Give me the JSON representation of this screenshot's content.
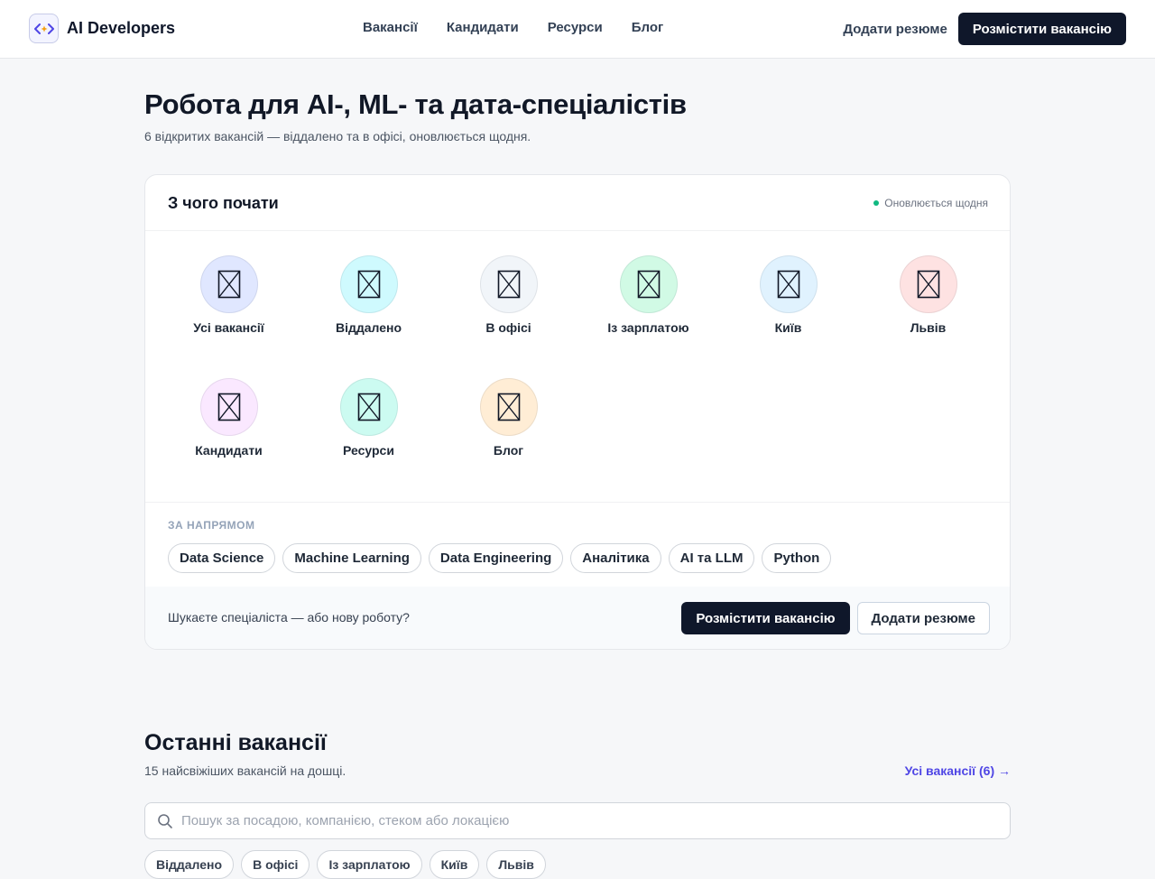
{
  "brand": {
    "name": "AI Developers",
    "icon": "code-brackets-icon",
    "accent": "#4f46e5"
  },
  "nav": {
    "items": [
      "Вакансії",
      "Кандидати",
      "Ресурси",
      "Блог"
    ]
  },
  "header": {
    "add_resume": "Додати резюме",
    "post_job": "Розмістити вакансію"
  },
  "hero": {
    "title": "Робота для AI-, ML- та дата-спеціалістів",
    "subtitle": "6 відкритих вакансій — віддалено та в офісі, оновлюється щодня."
  },
  "start": {
    "title": "З чого почати",
    "status": "Оновлюється щодня",
    "status_color": "#10b981",
    "tiles": [
      {
        "label": "Усі вакансії",
        "icon": "image-placeholder-icon",
        "color": "#e0e7ff"
      },
      {
        "label": "Віддалено",
        "icon": "image-placeholder-icon",
        "color": "#cffafe"
      },
      {
        "label": "В офісі",
        "icon": "image-placeholder-icon",
        "color": "#f1f5f9"
      },
      {
        "label": "Із зарплатою",
        "icon": "image-placeholder-icon",
        "color": "#d1fae5"
      },
      {
        "label": "Київ",
        "icon": "image-placeholder-icon",
        "color": "#e0f2fe"
      },
      {
        "label": "Львів",
        "icon": "image-placeholder-icon",
        "color": "#fee2e2"
      },
      {
        "label": "Кандидати",
        "icon": "image-placeholder-icon",
        "color": "#fae8ff"
      },
      {
        "label": "Ресурси",
        "icon": "image-placeholder-icon",
        "color": "#ccfbf1"
      },
      {
        "label": "Блог",
        "icon": "image-placeholder-icon",
        "color": "#ffedd5"
      }
    ],
    "direction_label": "ЗА НАПРЯМОМ",
    "directions": [
      "Data Science",
      "Machine Learning",
      "Data Engineering",
      "Аналітика",
      "AI та LLM",
      "Python"
    ],
    "cta_text": "Шукаєте спеціаліста — або нову роботу?",
    "cta_post": "Розмістити вакансію",
    "cta_resume": "Додати резюме"
  },
  "jobs": {
    "title": "Останні вакансії",
    "subtitle": "15 найсвіжіших вакансій на дошці.",
    "all_link": "Усі вакансії (6) →",
    "search_placeholder": "Пошук за посадою, компанією, стеком або локацією",
    "search_value": "",
    "filters": [
      "Віддалено",
      "В офісі",
      "Із зарплатою",
      "Київ",
      "Львів"
    ]
  }
}
